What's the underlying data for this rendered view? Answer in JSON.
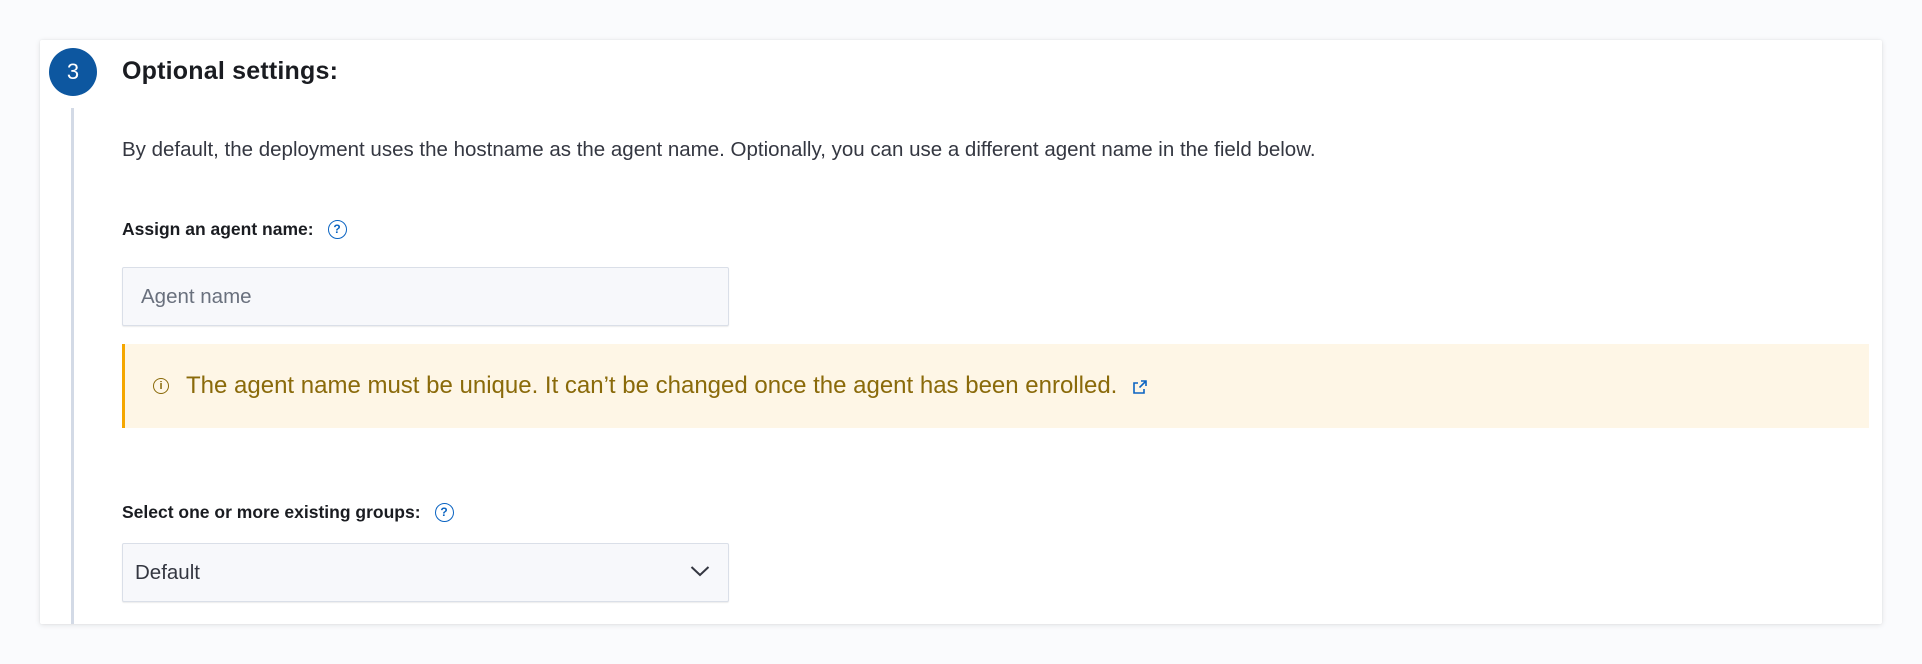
{
  "step": {
    "number": "3",
    "title": "Optional settings:",
    "description": "By default, the deployment uses the hostname as the agent name. Optionally, you can use a different agent name in the field below."
  },
  "agent_name": {
    "label": "Assign an agent name:",
    "placeholder": "Agent name",
    "value": ""
  },
  "callout": {
    "text": "The agent name must be unique. It can’t be changed once the agent has been enrolled."
  },
  "groups": {
    "label": "Select one or more existing groups:",
    "selected": "Default"
  },
  "icons": {
    "help": "question-circle-icon",
    "info": "info-circle-icon",
    "external": "external-link-icon",
    "dropdown": "chevron-down-icon"
  },
  "colors": {
    "step_badge": "#0d57a0",
    "link_blue": "#0b64c2",
    "callout_bg": "#fef6e6",
    "callout_border": "#f5a700",
    "callout_text": "#8a6a0a"
  }
}
